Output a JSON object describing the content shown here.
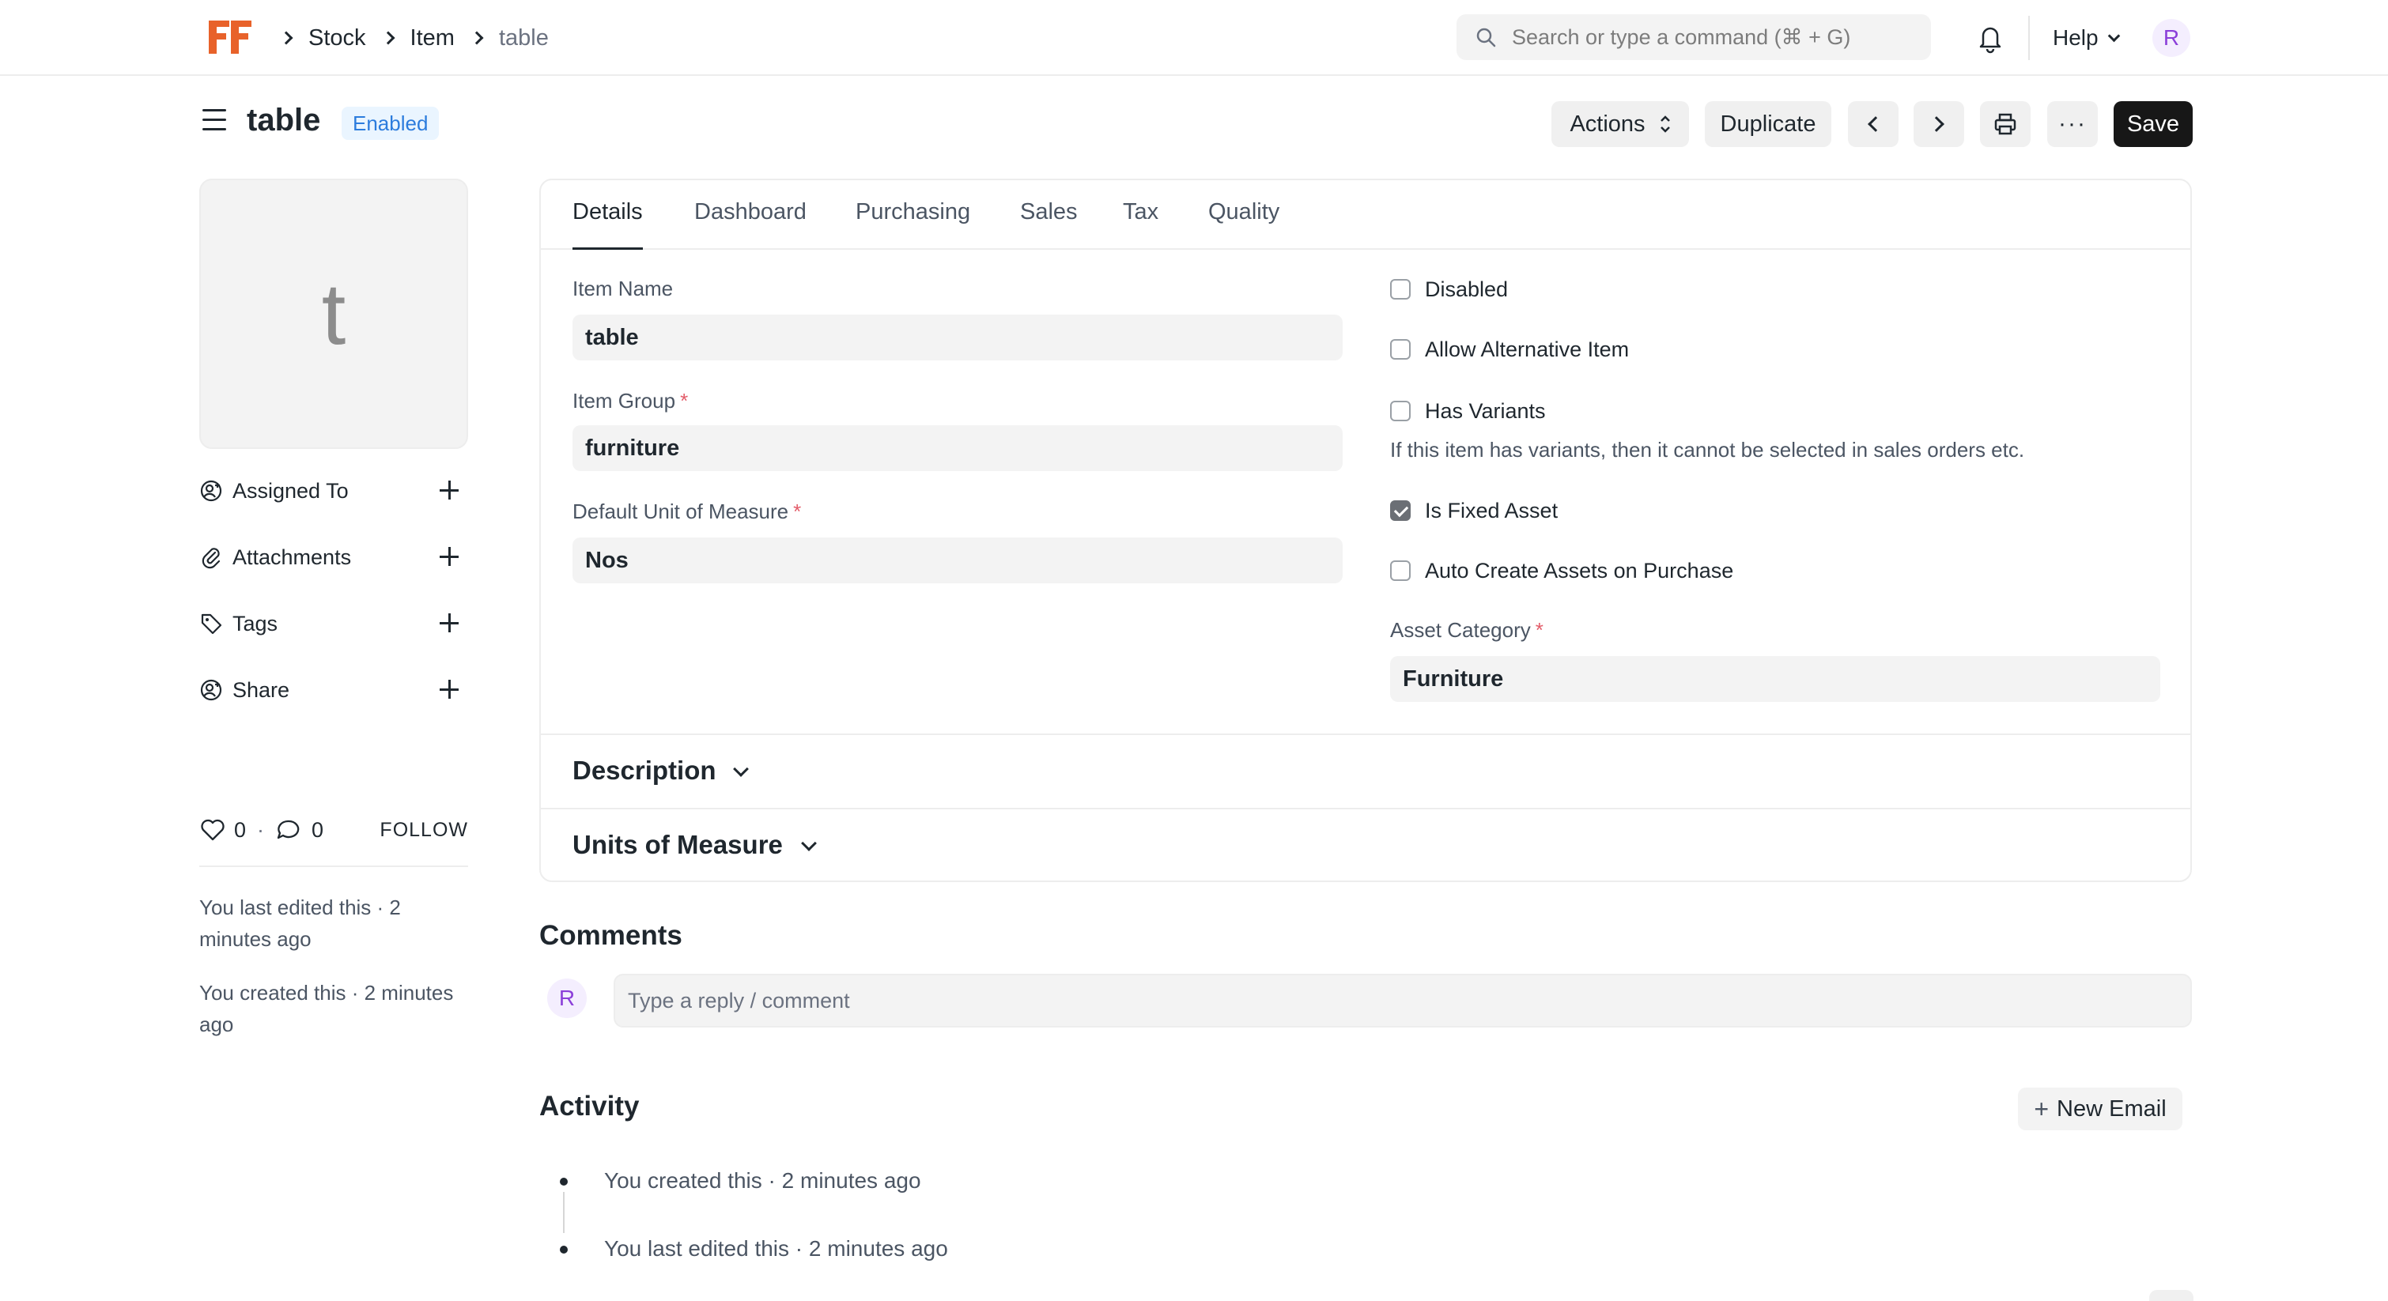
{
  "breadcrumb": [
    "Stock",
    "Item",
    "table"
  ],
  "search": {
    "placeholder": "Search or type a command (⌘ + G)"
  },
  "navbar": {
    "help_label": "Help",
    "user_initial": "R"
  },
  "header": {
    "title": "table",
    "status": "Enabled",
    "actions_label": "Actions",
    "duplicate_label": "Duplicate",
    "more_label": "···",
    "save_label": "Save"
  },
  "sidebar": {
    "image_letter": "t",
    "items": [
      {
        "label": "Assigned To",
        "icon": "assign-icon"
      },
      {
        "label": "Attachments",
        "icon": "paperclip-icon"
      },
      {
        "label": "Tags",
        "icon": "tag-icon"
      },
      {
        "label": "Share",
        "icon": "share-icon"
      }
    ],
    "likes": "0",
    "comments_count": "0",
    "follow_label": "FOLLOW",
    "last_edited": "You last edited this · 2 minutes ago",
    "created": "You created this · 2 minutes ago"
  },
  "tabs": [
    "Details",
    "Dashboard",
    "Purchasing",
    "Sales",
    "Tax",
    "Quality"
  ],
  "form": {
    "item_name_label": "Item Name",
    "item_name_value": "table",
    "item_group_label": "Item Group",
    "item_group_value": "furniture",
    "uom_label": "Default Unit of Measure",
    "uom_value": "Nos",
    "required_mark": "*",
    "checkboxes": [
      {
        "label": "Disabled",
        "checked": false
      },
      {
        "label": "Allow Alternative Item",
        "checked": false
      },
      {
        "label": "Has Variants",
        "checked": false
      },
      {
        "label": "Is Fixed Asset",
        "checked": true
      },
      {
        "label": "Auto Create Assets on Purchase",
        "checked": false
      }
    ],
    "variants_help": "If this item has variants, then it cannot be selected in sales orders etc.",
    "asset_category_label": "Asset Category",
    "asset_category_value": "Furniture"
  },
  "sections": [
    "Description",
    "Units of Measure"
  ],
  "comments": {
    "title": "Comments",
    "avatar_initial": "R",
    "placeholder": "Type a reply / comment"
  },
  "activity": {
    "title": "Activity",
    "new_email_label": "New Email",
    "items": [
      "You created this · 2 minutes ago",
      "You last edited this · 2 minutes ago"
    ]
  },
  "colors": {
    "accent": "#171717",
    "badge_bg": "#eaf5ff",
    "badge_text": "#2c7cdd",
    "logo": "#e8622a",
    "user_accent": "#8b3fd9"
  }
}
